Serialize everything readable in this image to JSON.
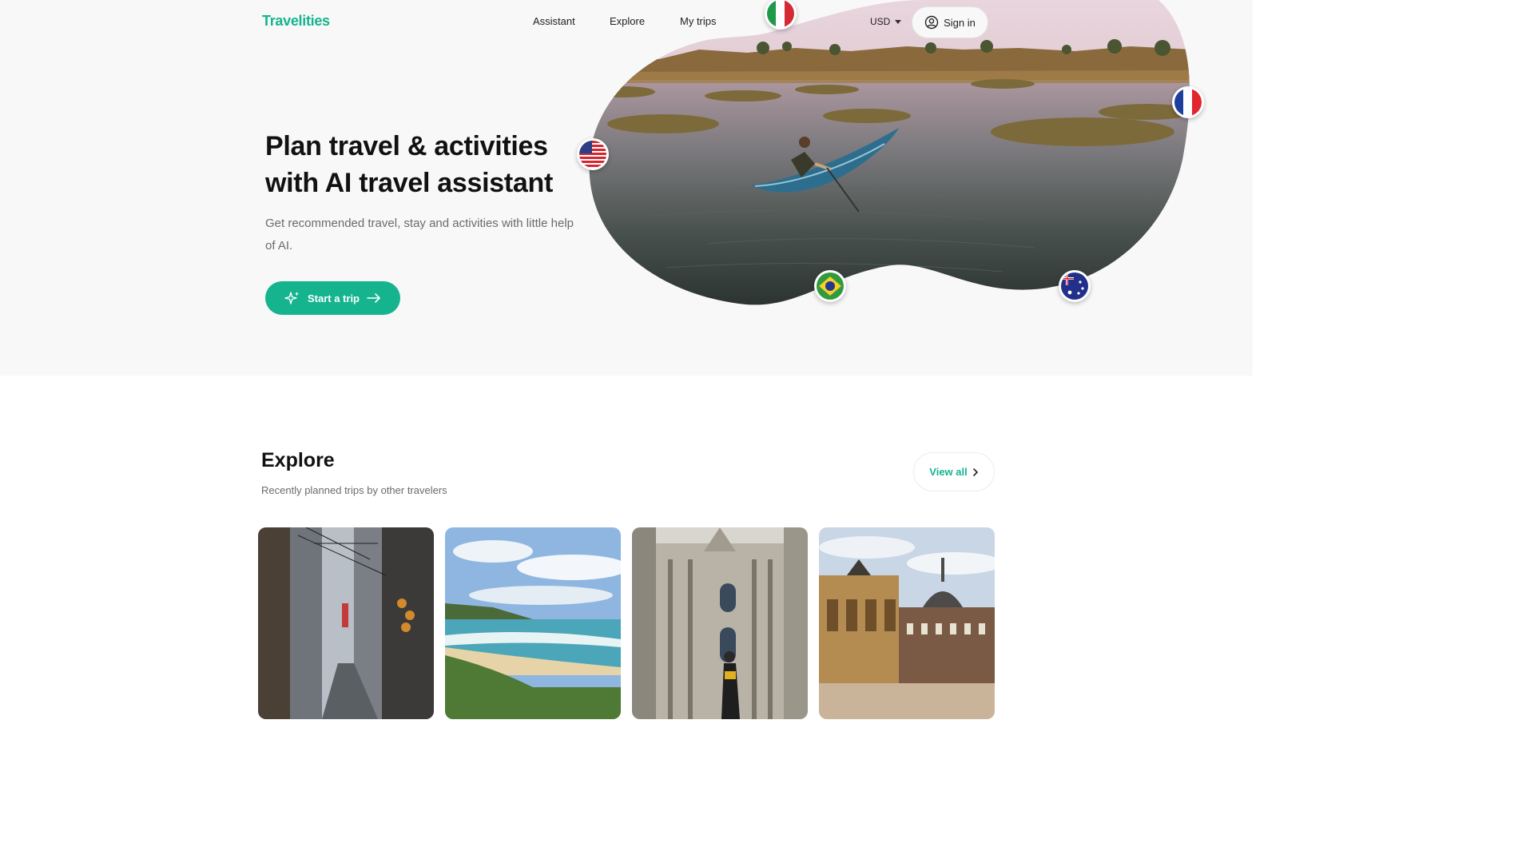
{
  "header": {
    "logo": "Travelities",
    "nav": [
      "Assistant",
      "Explore",
      "My trips"
    ],
    "currency": "USD",
    "signin_label": "Sign in"
  },
  "hero": {
    "title": "Plan travel & activities with AI travel assistant",
    "subtitle": "Get recommended travel, stay and activities with little help of AI.",
    "cta_label": "Start a trip",
    "flags": [
      "italy-flag-icon",
      "france-flag-icon",
      "usa-flag-icon",
      "brazil-flag-icon",
      "australia-flag-icon"
    ]
  },
  "explore": {
    "title": "Explore",
    "subtitle": "Recently planned trips by other travelers",
    "view_all_label": "View all"
  },
  "colors": {
    "accent": "#15b48f",
    "hero_bg": "#f8f8f8"
  }
}
